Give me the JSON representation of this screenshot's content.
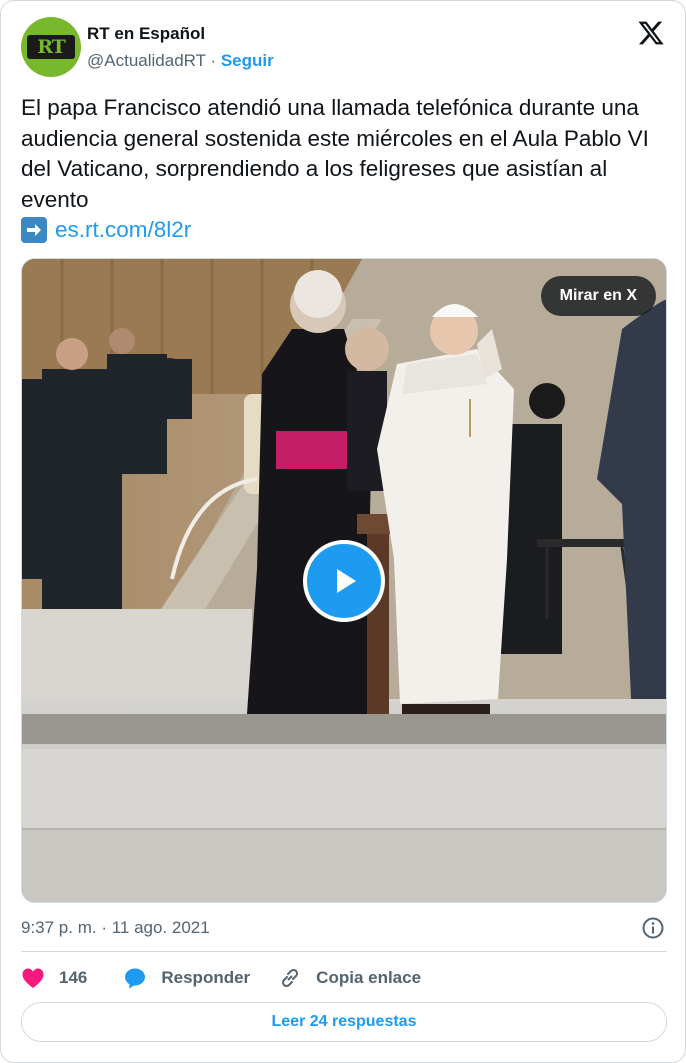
{
  "author": {
    "name": "RT en Español",
    "handle": "@ActualidadRT",
    "separator": " · ",
    "follow_label": "Seguir",
    "avatar_text": "RT"
  },
  "tweet": {
    "text": "El papa Francisco atendió una llamada telefónica durante una audiencia general sostenida este miércoles en el Aula Pablo VI del Vaticano, sorprendiendo a los feligreses que asistían al evento",
    "link": "es.rt.com/8l2r"
  },
  "media": {
    "watch_label": "Mirar en X"
  },
  "meta": {
    "timestamp": "9:37 p. m. · 11 ago. 2021"
  },
  "actions": {
    "like_count": "146",
    "reply_label": "Responder",
    "copy_label": "Copia enlace"
  },
  "footer": {
    "read_replies_label": "Leer 24 respuestas"
  },
  "colors": {
    "accent": "#1d9bf0",
    "like": "#f91880",
    "brand_green": "#77b82c"
  },
  "icons": [
    "x-logo-icon",
    "info-icon",
    "heart-icon",
    "reply-bubble-icon",
    "link-icon",
    "play-icon",
    "arrow-right-icon"
  ]
}
